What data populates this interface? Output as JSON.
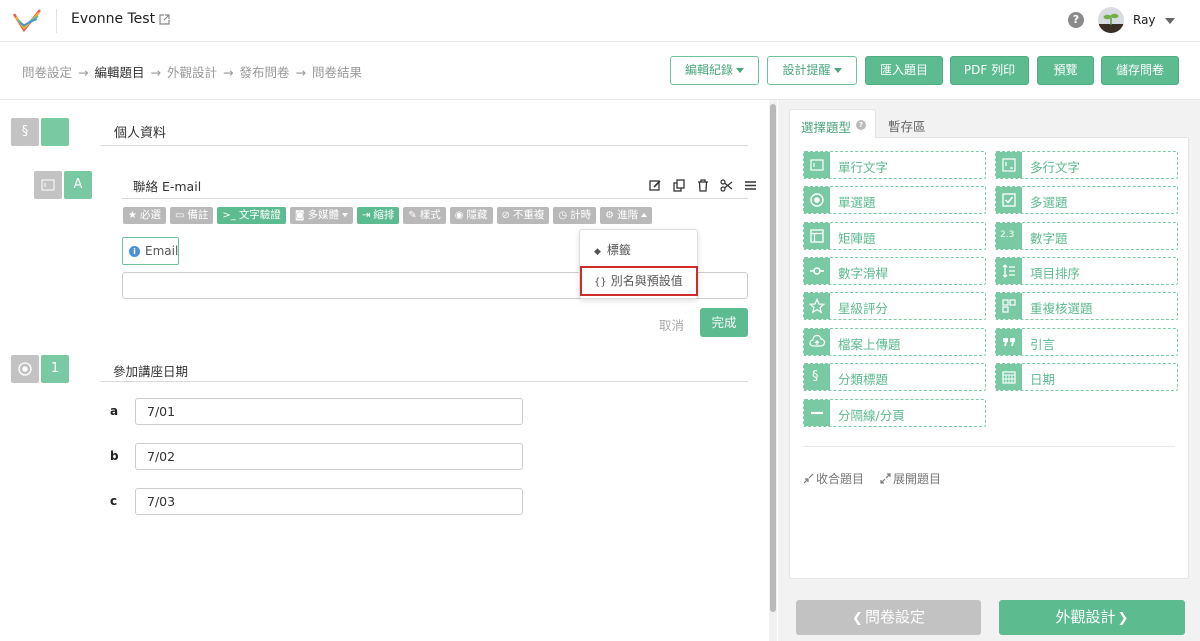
{
  "header": {
    "app_title": "Evonne Test",
    "user_name": "Ray",
    "help_glyph": "?"
  },
  "breadcrumb": [
    {
      "label": "問卷設定",
      "current": false
    },
    {
      "label": "編輯題目",
      "current": true
    },
    {
      "label": "外觀設計",
      "current": false
    },
    {
      "label": "發布問卷",
      "current": false
    },
    {
      "label": "問卷結果",
      "current": false
    }
  ],
  "breadcrumb_separator": "→",
  "toolbar": {
    "edit_log": "編輯紀錄",
    "design_tips": "設計提醒",
    "import": "匯入題目",
    "pdf": "PDF 列印",
    "preview": "預覽",
    "save": "儲存問卷"
  },
  "section": {
    "badge": "§",
    "title": "個人資料"
  },
  "question_email": {
    "badge_letter": "A",
    "title": "聯絡 E-mail",
    "tools": [
      {
        "label": "必選",
        "icon": "star-icon",
        "glyph": "★",
        "active": false
      },
      {
        "label": "備註",
        "icon": "comment-icon",
        "glyph": "▭",
        "active": false
      },
      {
        "label": "文字驗證",
        "icon": "terminal-icon",
        "glyph": ">_",
        "active": true
      },
      {
        "label": "多媒體",
        "icon": "camera-icon",
        "glyph": "◙",
        "active": false
      },
      {
        "label": "縮排",
        "icon": "indent-icon",
        "glyph": "⇥",
        "active": true
      },
      {
        "label": "樣式",
        "icon": "brush-icon",
        "glyph": "✎",
        "active": false
      },
      {
        "label": "隱藏",
        "icon": "eye-slash-icon",
        "glyph": "◉",
        "active": false
      },
      {
        "label": "不重複",
        "icon": "ban-icon",
        "glyph": "⊘",
        "active": false
      },
      {
        "label": "計時",
        "icon": "clock-icon",
        "glyph": "◷",
        "active": false
      },
      {
        "label": "進階",
        "icon": "gear-icon",
        "glyph": "⚙",
        "active": false
      }
    ],
    "validation_tag": "Email",
    "info_glyph": "i",
    "input_value": "",
    "cancel": "取消",
    "done": "完成"
  },
  "advanced_menu": {
    "items": [
      {
        "label": "標籤",
        "icon": "tag-icon",
        "glyph": "◆"
      },
      {
        "label": "別名與預設值",
        "icon": "braces-icon",
        "glyph": "{}"
      }
    ]
  },
  "question_date": {
    "number": "1",
    "title": "參加講座日期",
    "options": [
      {
        "key": "a",
        "value": "7/01"
      },
      {
        "key": "b",
        "value": "7/02"
      },
      {
        "key": "c",
        "value": "7/03"
      }
    ]
  },
  "right_panel": {
    "tabs": [
      {
        "label": "選擇題型",
        "active": true
      },
      {
        "label": "暫存區",
        "active": false
      }
    ],
    "question_types": [
      {
        "label": "單行文字",
        "icon": "single-line-text-icon"
      },
      {
        "label": "多行文字",
        "icon": "multi-line-text-icon"
      },
      {
        "label": "單選題",
        "icon": "radio-icon"
      },
      {
        "label": "多選題",
        "icon": "checkbox-icon"
      },
      {
        "label": "矩陣題",
        "icon": "matrix-icon"
      },
      {
        "label": "數字題",
        "icon": "number-icon",
        "glyph": "2.3"
      },
      {
        "label": "數字滑桿",
        "icon": "slider-icon"
      },
      {
        "label": "項目排序",
        "icon": "sort-icon"
      },
      {
        "label": "星級評分",
        "icon": "star-rating-icon"
      },
      {
        "label": "重複核選題",
        "icon": "repeat-check-icon"
      },
      {
        "label": "檔案上傳題",
        "icon": "upload-icon"
      },
      {
        "label": "引言",
        "icon": "quote-icon"
      },
      {
        "label": "分類標題",
        "icon": "section-icon",
        "glyph": "§"
      },
      {
        "label": "日期",
        "icon": "calendar-icon"
      },
      {
        "label": "分隔線/分頁",
        "icon": "divider-icon"
      }
    ],
    "collapse": "收合題目",
    "expand": "展開題目"
  },
  "footer": {
    "prev": "問卷設定",
    "next": "外觀設計",
    "prev_glyph": "❮",
    "next_glyph": "❯"
  },
  "colors": {
    "accent": "#5cbb8f",
    "accent_light": "#79c9a2",
    "inactive": "#c3c3c3",
    "highlight": "#d02b2b"
  }
}
